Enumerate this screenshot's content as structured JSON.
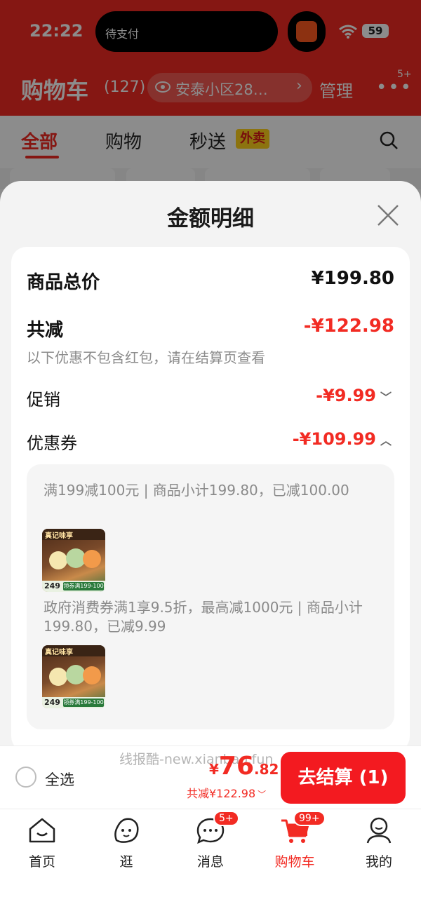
{
  "status_bar": {
    "time": "22:22",
    "island_text": "待支付",
    "battery": "59"
  },
  "header": {
    "title": "购物车",
    "count": "(127)",
    "address": "安泰小区28…",
    "manage": "管理",
    "more_badge": "5+"
  },
  "tabs": {
    "all": "全部",
    "shopping": "购物",
    "instant": "秒送",
    "instant_badge": "外卖"
  },
  "modal": {
    "title": "金额明细",
    "total_label": "商品总价",
    "total_value": "¥199.80",
    "discount_label": "共减",
    "discount_value": "-¥122.98",
    "discount_note": "以下优惠不包含红包，请在结算页查看",
    "promo_label": "促销",
    "promo_value": "-¥9.99",
    "coupon_label": "优惠券",
    "coupon_value": "-¥109.99",
    "coupons": [
      {
        "desc": "满199减100元 | 商品小计199.80，已减100.00"
      },
      {
        "desc": "政府消费券满1享9.5折，最高减1000元 | 商品小计199.80，已减9.99"
      }
    ],
    "thumb_brand": "真记味享",
    "thumb_price": "249",
    "thumb_tag": "领券满199-100"
  },
  "checkout": {
    "select_all": "全选",
    "watermark": "线报酷-new.xianbao.fun",
    "price_symbol": "¥",
    "price_int": "76",
    "price_dec": ".82",
    "discount": "共减¥122.98",
    "button": "去结算 (1)"
  },
  "tabbar": {
    "items": [
      {
        "label": "首页"
      },
      {
        "label": "逛"
      },
      {
        "label": "消息",
        "badge": "5+"
      },
      {
        "label": "购物车",
        "badge": "99+"
      },
      {
        "label": "我的"
      }
    ]
  },
  "colors": {
    "brand_red": "#f22b23",
    "checkout_red": "#f31a20",
    "badge_yellow": "#ffd21c"
  }
}
